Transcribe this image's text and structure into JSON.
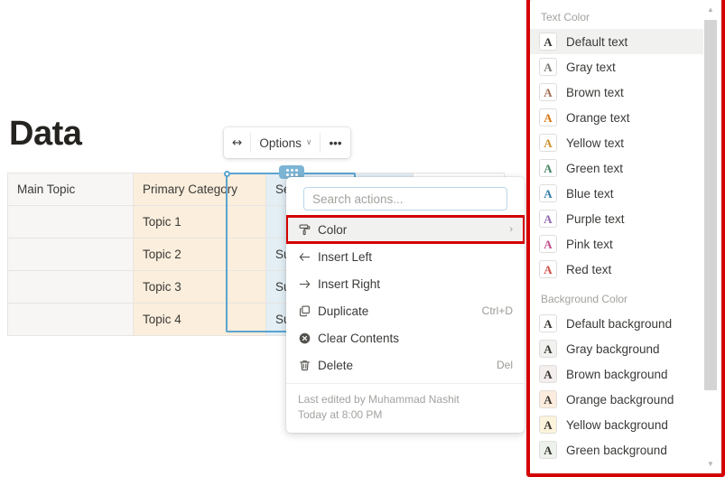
{
  "document": {
    "title": "Data"
  },
  "table": {
    "columns": [
      {
        "key": "main",
        "header": "Main Topic",
        "class": "col-main"
      },
      {
        "key": "prim",
        "header": "Primary Category",
        "class": "col-prim"
      },
      {
        "key": "sec",
        "header": "Secondary",
        "class": "col-sec"
      },
      {
        "key": "extra",
        "header": "",
        "class": "col-extra"
      }
    ],
    "rows": [
      {
        "main": "",
        "prim": "Topic 1",
        "sec": "",
        "extra": ""
      },
      {
        "main": "",
        "prim": "Topic 2",
        "sec": "Subtopic",
        "extra": ""
      },
      {
        "main": "",
        "prim": "Topic 3",
        "sec": "Subtopic",
        "extra": ""
      },
      {
        "main": "",
        "prim": "Topic 4",
        "sec": "Subtopic",
        "extra": ""
      }
    ],
    "header_main": "Main Topic",
    "header_primary": "Primary Category",
    "header_secondary": "Secondary",
    "r1_primary": "Topic 1",
    "r1_secondary": "",
    "r2_primary": "Topic 2",
    "r2_secondary": "Subtopic",
    "r3_primary": "Topic 3",
    "r3_secondary": "Subtopic",
    "r4_primary": "Topic 4",
    "r4_secondary": "Subtopic",
    "selected_column": "Secondary",
    "colors": {
      "main_bg": "#f7f6f5",
      "primary_bg": "#fbeedc",
      "secondary_bg": "#e3eef5",
      "selection_border": "#5ba4cf",
      "drag_handle": "#7cb4d4"
    }
  },
  "toolbar": {
    "resize_icon": "↔",
    "options_label": "Options",
    "options_chevron": "∨",
    "more_label": "•••"
  },
  "context_menu": {
    "search_placeholder": "Search actions...",
    "search_value": "",
    "items": [
      {
        "label": "Color",
        "icon": "paint-roller-icon",
        "shortcut": "",
        "arrow": "›",
        "highlighted": true
      },
      {
        "label": "Insert Left",
        "icon": "arrow-left-icon",
        "shortcut": "",
        "arrow": "",
        "highlighted": false
      },
      {
        "label": "Insert Right",
        "icon": "arrow-right-icon",
        "shortcut": "",
        "arrow": "",
        "highlighted": false
      },
      {
        "label": "Duplicate",
        "icon": "duplicate-icon",
        "shortcut": "Ctrl+D",
        "arrow": "",
        "highlighted": false
      },
      {
        "label": "Clear Contents",
        "icon": "clear-icon",
        "shortcut": "",
        "arrow": "",
        "highlighted": false
      },
      {
        "label": "Delete",
        "icon": "trash-icon",
        "shortcut": "Del",
        "arrow": "",
        "highlighted": false
      }
    ],
    "footer": {
      "last_edited": "Last edited by Muhammad Nashit",
      "timestamp": "Today at 8:00 PM"
    },
    "highlight_color": "#d40000"
  },
  "color_panel": {
    "text_section_title": "Text Color",
    "background_section_title": "Background Color",
    "highlight_color": "#d40000",
    "text_colors": [
      {
        "label": "Default text",
        "glyph": "A",
        "fg": "#37352f",
        "bg": "#ffffff",
        "selected": true
      },
      {
        "label": "Gray text",
        "glyph": "A",
        "fg": "#787774",
        "bg": "#ffffff",
        "selected": false
      },
      {
        "label": "Brown text",
        "glyph": "A",
        "fg": "#9f6b53",
        "bg": "#ffffff",
        "selected": false
      },
      {
        "label": "Orange text",
        "glyph": "A",
        "fg": "#d9730d",
        "bg": "#ffffff",
        "selected": false
      },
      {
        "label": "Yellow text",
        "glyph": "A",
        "fg": "#cb912f",
        "bg": "#ffffff",
        "selected": false
      },
      {
        "label": "Green text",
        "glyph": "A",
        "fg": "#448361",
        "bg": "#ffffff",
        "selected": false
      },
      {
        "label": "Blue text",
        "glyph": "A",
        "fg": "#337ea9",
        "bg": "#ffffff",
        "selected": false
      },
      {
        "label": "Purple text",
        "glyph": "A",
        "fg": "#9065b0",
        "bg": "#ffffff",
        "selected": false
      },
      {
        "label": "Pink text",
        "glyph": "A",
        "fg": "#c14c8a",
        "bg": "#ffffff",
        "selected": false
      },
      {
        "label": "Red text",
        "glyph": "A",
        "fg": "#d44c47",
        "bg": "#ffffff",
        "selected": false
      }
    ],
    "background_colors": [
      {
        "label": "Default background",
        "glyph": "A",
        "fg": "#37352f",
        "bg": "#ffffff",
        "selected": false
      },
      {
        "label": "Gray background",
        "glyph": "A",
        "fg": "#37352f",
        "bg": "#f1f1ef",
        "selected": false
      },
      {
        "label": "Brown background",
        "glyph": "A",
        "fg": "#37352f",
        "bg": "#f4eeee",
        "selected": false
      },
      {
        "label": "Orange background",
        "glyph": "A",
        "fg": "#37352f",
        "bg": "#fbecdd",
        "selected": false
      },
      {
        "label": "Yellow background",
        "glyph": "A",
        "fg": "#37352f",
        "bg": "#fbf3db",
        "selected": false
      },
      {
        "label": "Green background",
        "glyph": "A",
        "fg": "#37352f",
        "bg": "#edf3ec",
        "selected": false
      }
    ],
    "scrollbar": {
      "up_arrow": "▲",
      "down_arrow": "▼"
    }
  }
}
